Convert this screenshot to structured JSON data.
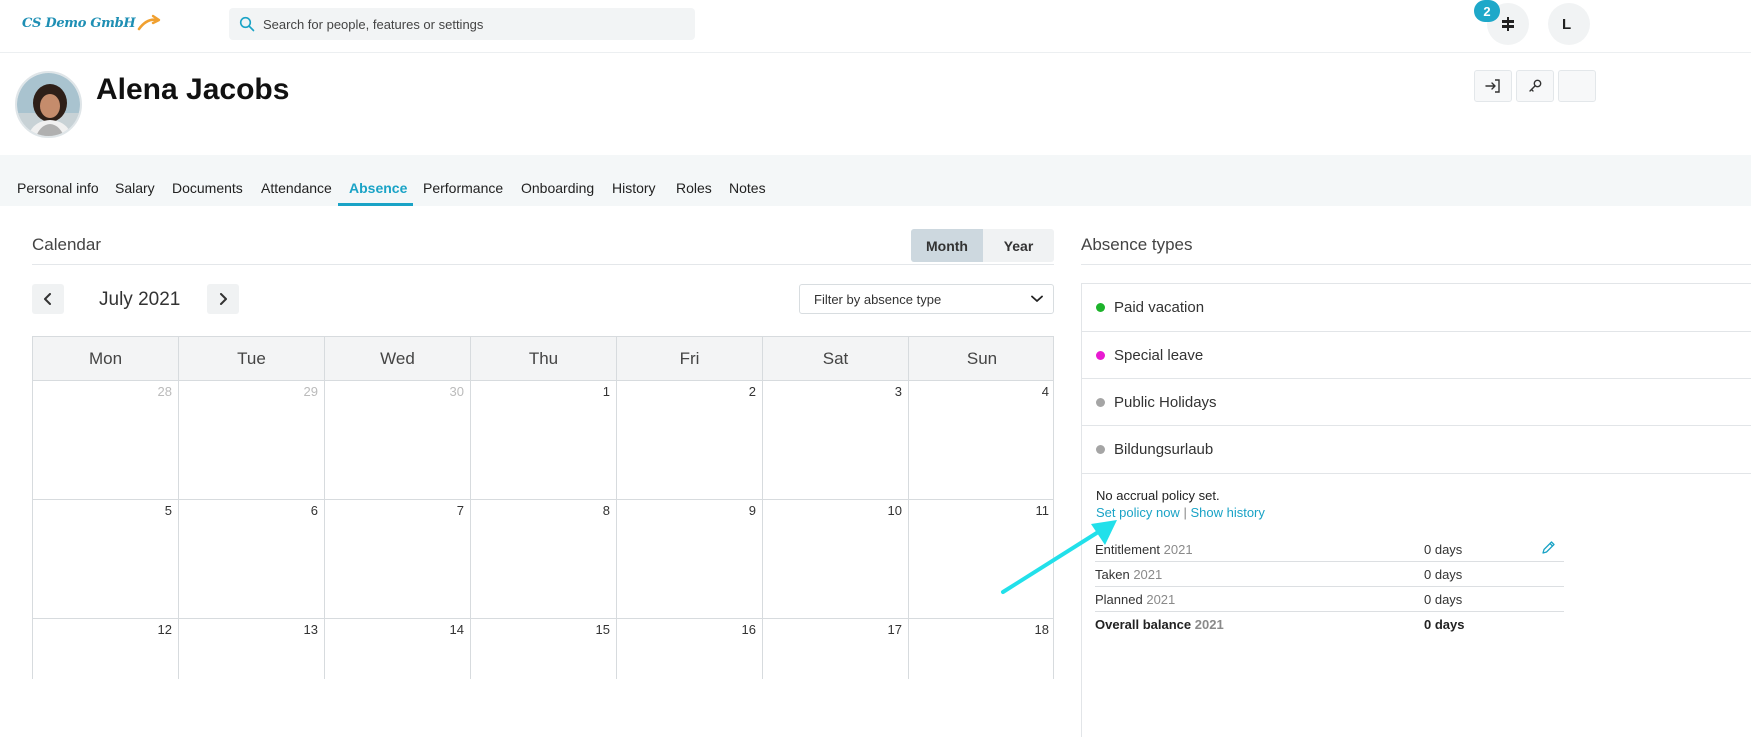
{
  "topbar": {
    "logo_text": "CS Demo GmbH",
    "search_placeholder": "Search for people, features or settings",
    "notification_count": "2",
    "user_initial": "L"
  },
  "profile": {
    "name": "Alena Jacobs"
  },
  "tabs": [
    {
      "label": "Personal info"
    },
    {
      "label": "Salary"
    },
    {
      "label": "Documents"
    },
    {
      "label": "Attendance"
    },
    {
      "label": "Absence",
      "active": true
    },
    {
      "label": "Performance"
    },
    {
      "label": "Onboarding"
    },
    {
      "label": "History"
    },
    {
      "label": "Roles"
    },
    {
      "label": "Notes"
    }
  ],
  "calendar": {
    "title": "Calendar",
    "view_month": "Month",
    "view_year": "Year",
    "month_label": "July 2021",
    "filter_label": "Filter by absence type",
    "weekdays": [
      "Mon",
      "Tue",
      "Wed",
      "Thu",
      "Fri",
      "Sat",
      "Sun"
    ],
    "weeks": [
      [
        "28",
        "29",
        "30",
        "1",
        "2",
        "3",
        "4"
      ],
      [
        "5",
        "6",
        "7",
        "8",
        "9",
        "10",
        "11"
      ],
      [
        "12",
        "13",
        "14",
        "15",
        "16",
        "17",
        "18"
      ]
    ]
  },
  "absence_types": {
    "title": "Absence types",
    "items": [
      {
        "label": "Paid vacation",
        "color": "#1db32b"
      },
      {
        "label": "Special leave",
        "color": "#e81ad1"
      },
      {
        "label": "Public Holidays",
        "color": "#a5a5a5"
      },
      {
        "label": "Bildungsurlaub",
        "color": "#a5a5a5"
      }
    ],
    "note": "No accrual policy set.",
    "set_policy_link": "Set policy now",
    "separator": "|",
    "show_history_link": "Show history",
    "stats": [
      {
        "label": "Entitlement",
        "year": "2021",
        "value": "0 days"
      },
      {
        "label": "Taken",
        "year": "2021",
        "value": "0 days"
      },
      {
        "label": "Planned",
        "year": "2021",
        "value": "0 days"
      },
      {
        "label": "Overall balance",
        "year": "2021",
        "value": "0 days"
      }
    ]
  },
  "colors": {
    "accent": "#1aa3c6",
    "annotation_arrow": "#22e0ea"
  }
}
